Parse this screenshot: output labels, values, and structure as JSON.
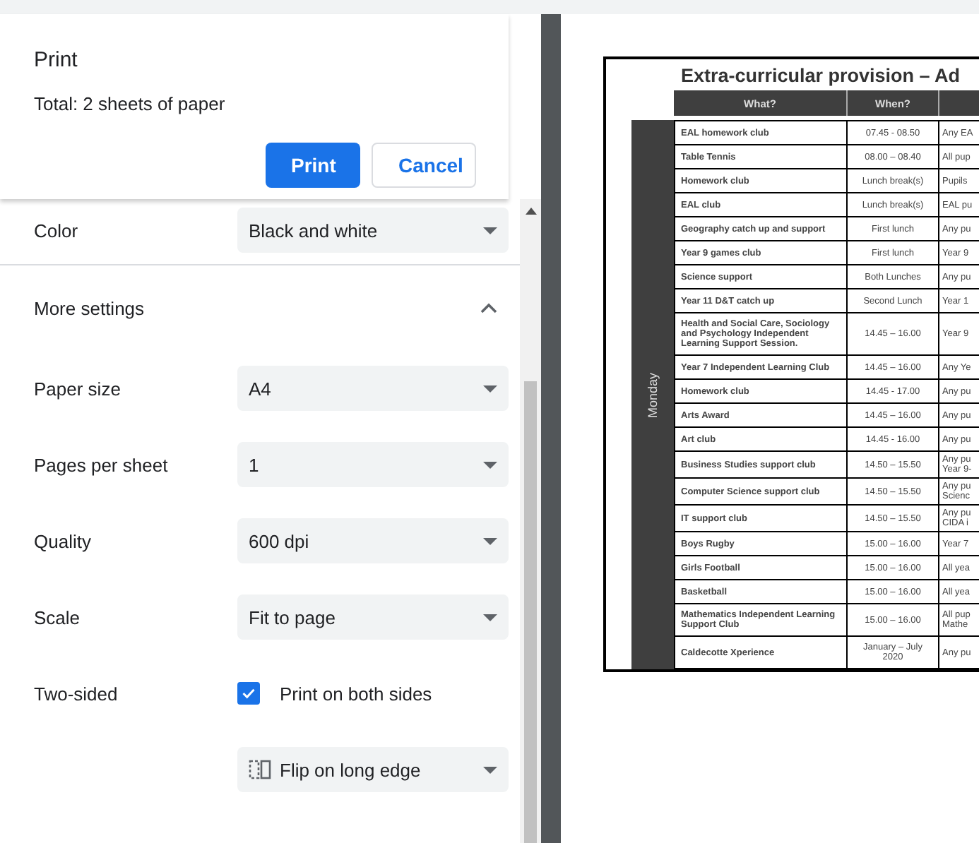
{
  "dialog": {
    "title": "Print",
    "total": "Total: 2 sheets of paper",
    "buttons": [
      {
        "kind": "primary",
        "label": "Print"
      },
      {
        "kind": "secondary",
        "label": "Cancel"
      }
    ]
  },
  "settings": [
    {
      "kind": "select",
      "label": "Color",
      "value": "Black and white"
    },
    {
      "kind": "section",
      "label": "More settings",
      "expanded": true
    },
    {
      "kind": "select",
      "label": "Paper size",
      "value": "A4"
    },
    {
      "kind": "select",
      "label": "Pages per sheet",
      "value": "1"
    },
    {
      "kind": "select",
      "label": "Quality",
      "value": "600 dpi"
    },
    {
      "kind": "select",
      "label": "Scale",
      "value": "Fit to page"
    },
    {
      "kind": "checkbox",
      "label": "Two-sided",
      "value": "Print on both sides",
      "checked": true
    },
    {
      "kind": "select-icon",
      "value": "Flip on long edge"
    }
  ],
  "preview": {
    "title": "Extra-curricular provision – Ad",
    "columns": [
      "What?",
      "When?"
    ],
    "day": "Monday",
    "rows": [
      {
        "what": "EAL homework club",
        "when": "07.45 - 08.50",
        "who": [
          "Any EA"
        ]
      },
      {
        "what": "Table Tennis",
        "when": "08.00 – 08.40",
        "who": [
          "All pup"
        ]
      },
      {
        "what": "Homework club",
        "when": "Lunch break(s)",
        "who": [
          "Pupils"
        ]
      },
      {
        "what": "EAL club",
        "when": "Lunch break(s)",
        "who": [
          "EAL pu"
        ]
      },
      {
        "what": "Geography catch up and support",
        "when": "First lunch",
        "who": [
          "Any pu"
        ]
      },
      {
        "what": "Year 9 games club",
        "when": "First lunch",
        "who": [
          "Year 9"
        ]
      },
      {
        "what": "Science support",
        "when": "Both Lunches",
        "who": [
          "Any pu"
        ]
      },
      {
        "what": "Year 11 D&T catch up",
        "when": "Second Lunch",
        "who": [
          "Year 1"
        ]
      },
      {
        "what": "Health and Social Care, Sociology and Psychology Independent Learning Support Session.",
        "when": "14.45 – 16.00",
        "who": [
          "Year 9"
        ]
      },
      {
        "what": "Year 7 Independent Learning Club",
        "when": "14.45 – 16.00",
        "who": [
          "Any Ye"
        ]
      },
      {
        "what": "Homework club",
        "when": "14.45 - 17.00",
        "who": [
          "Any pu"
        ]
      },
      {
        "what": "Arts Award",
        "when": "14.45 – 16.00",
        "who": [
          "Any pu"
        ]
      },
      {
        "what": "Art club",
        "when": "14.45 - 16.00",
        "who": [
          "Any pu"
        ]
      },
      {
        "what": "Business Studies support club",
        "when": "14.50 – 15.50",
        "who": [
          "Any pu",
          "Year 9-"
        ]
      },
      {
        "what": "Computer Science support club",
        "when": "14.50 – 15.50",
        "who": [
          "Any pu",
          "Scienc"
        ]
      },
      {
        "what": "IT support club",
        "when": "14.50 – 15.50",
        "who": [
          "Any pu",
          "CIDA i"
        ]
      },
      {
        "what": "Boys Rugby",
        "when": "15.00 – 16.00",
        "who": [
          "Year 7"
        ]
      },
      {
        "what": "Girls Football",
        "when": "15.00 – 16.00",
        "who": [
          "All yea"
        ]
      },
      {
        "what": "Basketball",
        "when": "15.00 – 16.00",
        "who": [
          "All yea"
        ]
      },
      {
        "what": "Mathematics Independent Learning Support Club",
        "when": "15.00 – 16.00",
        "who": [
          "All pup",
          "Mathe"
        ]
      },
      {
        "what": "Caldecotte Xperience",
        "when": "January – July 2020",
        "who": [
          "Any pu"
        ]
      }
    ]
  }
}
